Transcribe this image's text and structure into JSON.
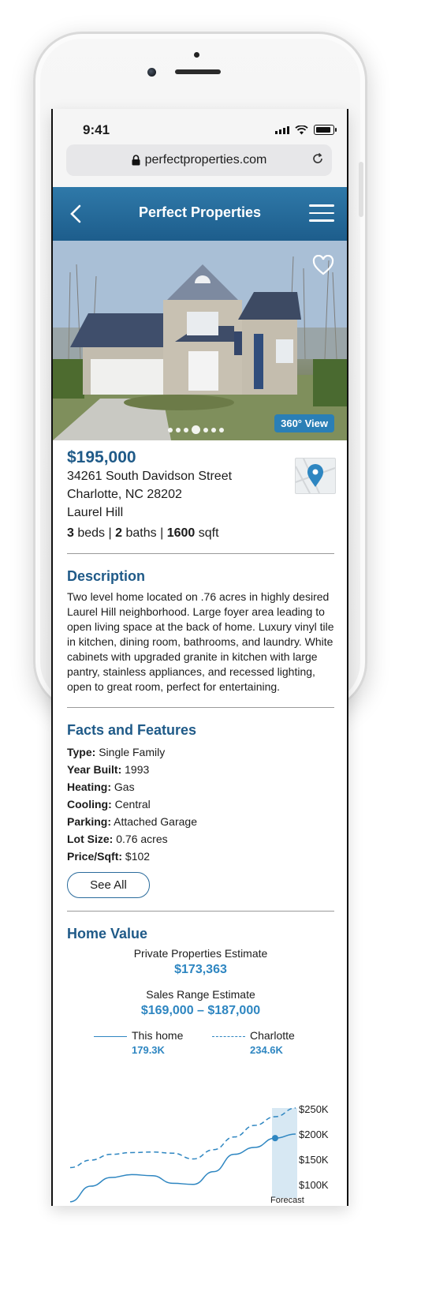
{
  "status_bar": {
    "time": "9:41"
  },
  "browser": {
    "url": "perfectproperties.com"
  },
  "nav": {
    "title": "Perfect Properties"
  },
  "photo": {
    "badge": "360° View",
    "dots_total": 7,
    "active_dot": 4
  },
  "listing": {
    "price": "$195,000",
    "street": "34261 South Davidson Street",
    "city": "Charlotte, NC 28202",
    "neighborhood": "Laurel Hill",
    "beds": "3",
    "beds_label": "beds",
    "baths": "2",
    "baths_label": "baths",
    "sqft": "1600",
    "sqft_label": "sqft",
    "separator": "|"
  },
  "description": {
    "title": "Description",
    "text": "Two level home located on .76 acres in highly desired Laurel Hill neighborhood. Large foyer area leading to open living space at the back of home. Luxury vinyl tile in kitchen, dining room, bathrooms, and laundry. White cabinets with upgraded granite in kitchen with large pantry, stainless appliances, and recessed lighting, open to great room, perfect for entertaining."
  },
  "facts": {
    "title": "Facts and Features",
    "rows": [
      {
        "label": "Type:",
        "value": "Single Family"
      },
      {
        "label": "Year Built:",
        "value": "1993"
      },
      {
        "label": "Heating:",
        "value": "Gas"
      },
      {
        "label": "Cooling:",
        "value": "Central"
      },
      {
        "label": "Parking:",
        "value": "Attached Garage"
      },
      {
        "label": "Lot Size:",
        "value": "0.76 acres"
      },
      {
        "label": "Price/Sqft:",
        "value": "$102"
      }
    ],
    "see_all": "See All"
  },
  "home_value": {
    "title": "Home Value",
    "estimate_label": "Private Properties Estimate",
    "estimate_value": "$173,363",
    "range_label": "Sales Range Estimate",
    "range_value": "$169,000 – $187,000",
    "legend": [
      {
        "name": "This home",
        "value": "179.3K",
        "style": "solid"
      },
      {
        "name": "Charlotte",
        "value": "234.6K",
        "style": "dashed"
      }
    ]
  },
  "chart_data": {
    "type": "line",
    "y_ticks": [
      "$250K",
      "$200K",
      "$150K",
      "$100K"
    ],
    "ylim": [
      100000,
      250000
    ],
    "forecast_label": "Forecast",
    "series": [
      {
        "name": "This home",
        "style": "solid",
        "values": [
          88000,
          115000,
          130000,
          135000,
          133000,
          120000,
          118000,
          140000,
          170000,
          182000,
          198000,
          205000
        ]
      },
      {
        "name": "Charlotte",
        "style": "dashed",
        "values": [
          147000,
          160000,
          170000,
          173000,
          174000,
          172000,
          162000,
          178000,
          200000,
          220000,
          235000,
          250000
        ]
      }
    ],
    "forecast_start_index": 10,
    "marker_index": 10
  },
  "colors": {
    "brand": "#1f5a88",
    "accent": "#2e86c1",
    "nav": "#2a6e9e"
  }
}
